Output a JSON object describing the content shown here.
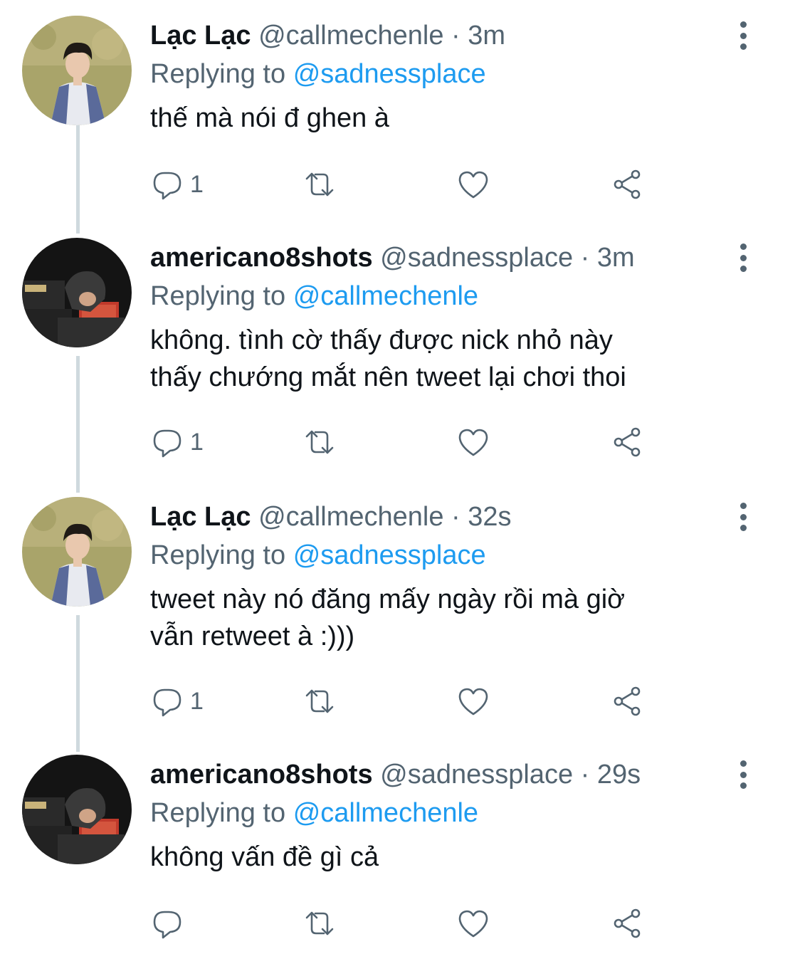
{
  "tweets": [
    {
      "name": "Lạc Lạc",
      "handle": "@callmechenle",
      "sep": "·",
      "time": "3m",
      "replying_label": "Replying to",
      "replying_to": "@sadnessplace",
      "text": "thế mà nói đ ghen à",
      "reply_count": "1",
      "avatar": "avatar-lac"
    },
    {
      "name": "americano8shots",
      "handle": "@sadnessplace",
      "sep": "·",
      "time": "3m",
      "replying_label": "Replying to",
      "replying_to": "@callmechenle",
      "text": "không. tình cờ thấy được nick nhỏ này\nthấy chướng mắt nên tweet lại chơi thoi",
      "reply_count": "1",
      "avatar": "avatar-americano"
    },
    {
      "name": "Lạc Lạc",
      "handle": "@callmechenle",
      "sep": "·",
      "time": "32s",
      "replying_label": "Replying to",
      "replying_to": "@sadnessplace",
      "text": "tweet này nó đăng mấy ngày rồi mà giờ\nvẫn retweet à :)))",
      "reply_count": "1",
      "avatar": "avatar-lac"
    },
    {
      "name": "americano8shots",
      "handle": "@sadnessplace",
      "sep": "·",
      "time": "29s",
      "replying_label": "Replying to",
      "replying_to": "@callmechenle",
      "text": "không vấn đề gì cả",
      "reply_count": "",
      "avatar": "avatar-americano"
    }
  ],
  "colors": {
    "link": "#1d9bf0",
    "secondary_text": "#536471",
    "primary_text": "#0f1419",
    "thread_line": "#cfd9de"
  },
  "icons": [
    "reply-icon",
    "retweet-icon",
    "like-icon",
    "share-icon",
    "more-icon"
  ]
}
